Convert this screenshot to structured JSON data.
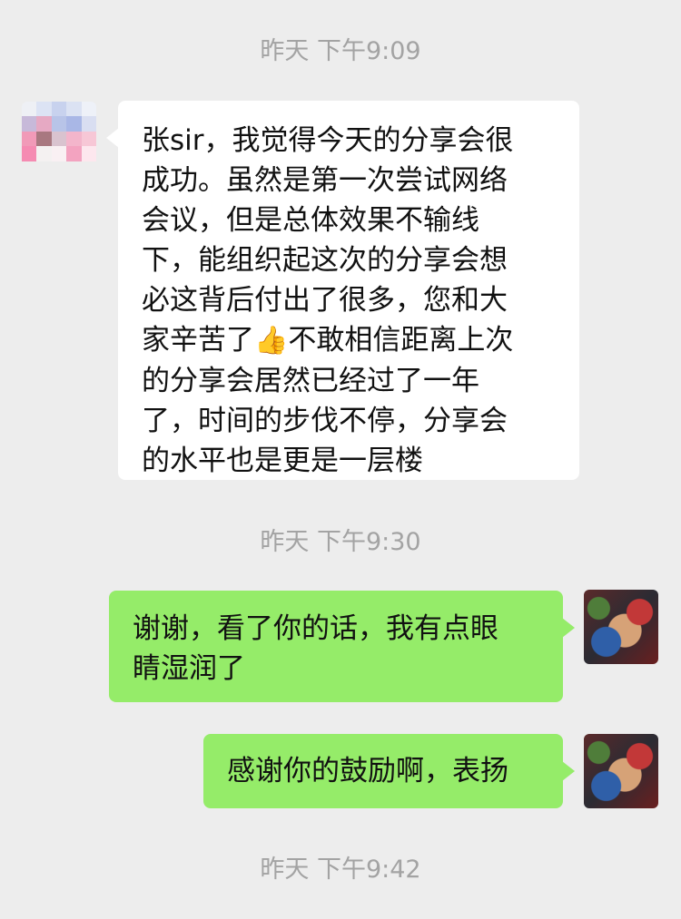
{
  "timestamps": [
    "昨天 下午9:09",
    "昨天 下午9:30",
    "昨天 下午9:42"
  ],
  "messages": [
    {
      "sender": "other",
      "lines": [
        "张sir，我觉得今天的分享会很",
        "成功。虽然是第一次尝试网络",
        "会议，但是总体效果不输线",
        "下，能组织起这次的分享会想",
        "必这背后付出了很多，您和大",
        "家辛苦了"
      ],
      "emoji": "👍",
      "lines_after": [
        "不敢相信距离上次",
        "的分享会居然已经过了一年",
        "了，时间的步伐不停，分享会",
        "的水平也是更是一层楼"
      ]
    },
    {
      "sender": "self",
      "lines": [
        "谢谢，看了你的话，我有点眼",
        "睛湿润了"
      ]
    },
    {
      "sender": "self",
      "lines": [
        "感谢你的鼓励啊，表扬"
      ]
    }
  ]
}
